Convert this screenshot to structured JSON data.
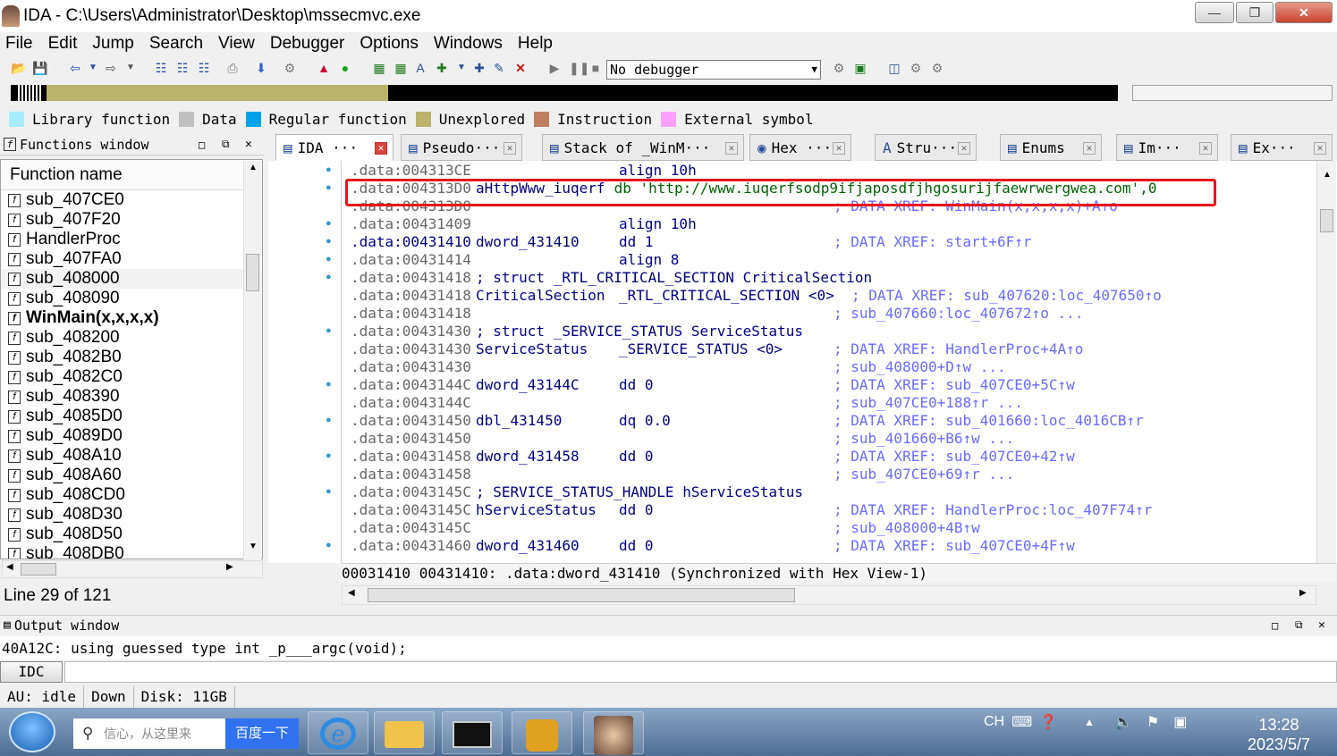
{
  "window": {
    "title": "IDA - C:\\Users\\Administrator\\Desktop\\mssecmvc.exe"
  },
  "menu": [
    "File",
    "Edit",
    "Jump",
    "Search",
    "View",
    "Debugger",
    "Options",
    "Windows",
    "Help"
  ],
  "toolbar": {
    "debugger_select": "No debugger"
  },
  "legend": [
    {
      "label": "Library function",
      "color": "#a7ecff"
    },
    {
      "label": "Data",
      "color": "#c0c0c0"
    },
    {
      "label": "Regular function",
      "color": "#00a2e8"
    },
    {
      "label": "Unexplored",
      "color": "#b9b36b"
    },
    {
      "label": "Instruction",
      "color": "#c08060"
    },
    {
      "label": "External symbol",
      "color": "#ffa0ff"
    }
  ],
  "functions": {
    "title": "Functions window",
    "column": "Function name",
    "items": [
      "sub_407CE0",
      "sub_407F20",
      "HandlerProc",
      "sub_407FA0",
      "sub_408000",
      "sub_408090",
      "WinMain(x,x,x,x)",
      "sub_408200",
      "sub_4082B0",
      "sub_4082C0",
      "sub_408390",
      "sub_4085D0",
      "sub_4089D0",
      "sub_408A10",
      "sub_408A60",
      "sub_408CD0",
      "sub_408D30",
      "sub_408D50",
      "sub_408DB0"
    ],
    "line_status": "Line 29 of 121"
  },
  "tabs": [
    "IDA ···",
    "Pseudo···",
    "Stack of _WinM···",
    "Hex ···",
    "Stru···",
    "Enums",
    "Im···",
    "Ex···"
  ],
  "disasm": {
    "lines": [
      {
        "addr": ".data:004313CE",
        "label": "",
        "op": "align 10h",
        "cmt": ""
      },
      {
        "addr": ".data:004313D0",
        "label": "aHttpWww_iuqerf",
        "op": "db 'http://www.iuqerfsodp9ifjaposdfjhgosurijfaewrwergwea.com',0",
        "cmt": ""
      },
      {
        "addr": ".data:004313D0",
        "label": "",
        "op": "",
        "cmt": "; DATA XREF: WinMain(x,x,x,x)+A↑o"
      },
      {
        "addr": ".data:00431409",
        "label": "",
        "op": "align 10h",
        "cmt": ""
      },
      {
        "addr": ".data:00431410",
        "label": "dword_431410",
        "op": "dd 1",
        "cmt": "; DATA XREF: start+6F↑r"
      },
      {
        "addr": ".data:00431414",
        "label": "",
        "op": "align 8",
        "cmt": ""
      },
      {
        "addr": ".data:00431418",
        "label": "; struct _RTL_CRITICAL_SECTION CriticalSection",
        "op": "",
        "cmt": ""
      },
      {
        "addr": ".data:00431418",
        "label": "CriticalSection",
        "op": "_RTL_CRITICAL_SECTION <0>",
        "cmt": "; DATA XREF: sub_407620:loc_407650↑o"
      },
      {
        "addr": ".data:00431418",
        "label": "",
        "op": "",
        "cmt": "; sub_407660:loc_407672↑o ..."
      },
      {
        "addr": ".data:00431430",
        "label": "; struct _SERVICE_STATUS ServiceStatus",
        "op": "",
        "cmt": ""
      },
      {
        "addr": ".data:00431430",
        "label": "ServiceStatus",
        "op": "_SERVICE_STATUS <0>",
        "cmt": "; DATA XREF: HandlerProc+4A↑o"
      },
      {
        "addr": ".data:00431430",
        "label": "",
        "op": "",
        "cmt": "; sub_408000+D↑w ..."
      },
      {
        "addr": ".data:0043144C",
        "label": "dword_43144C",
        "op": "dd 0",
        "cmt": "; DATA XREF: sub_407CE0+5C↑w"
      },
      {
        "addr": ".data:0043144C",
        "label": "",
        "op": "",
        "cmt": "; sub_407CE0+188↑r ..."
      },
      {
        "addr": ".data:00431450",
        "label": "dbl_431450",
        "op": "dq 0.0",
        "cmt": "; DATA XREF: sub_401660:loc_4016CB↑r"
      },
      {
        "addr": ".data:00431450",
        "label": "",
        "op": "",
        "cmt": "; sub_401660+B6↑w ..."
      },
      {
        "addr": ".data:00431458",
        "label": "dword_431458",
        "op": "dd 0",
        "cmt": "; DATA XREF: sub_407CE0+42↑w"
      },
      {
        "addr": ".data:00431458",
        "label": "",
        "op": "",
        "cmt": "; sub_407CE0+69↑r ..."
      },
      {
        "addr": ".data:0043145C",
        "label": "; SERVICE_STATUS_HANDLE hServiceStatus",
        "op": "",
        "cmt": ""
      },
      {
        "addr": ".data:0043145C",
        "label": "hServiceStatus",
        "op": "dd 0",
        "cmt": "; DATA XREF: HandlerProc:loc_407F74↑r"
      },
      {
        "addr": ".data:0043145C",
        "label": "",
        "op": "",
        "cmt": "; sub_408000+4B↑w"
      },
      {
        "addr": ".data:00431460",
        "label": "dword_431460",
        "op": "dd 0",
        "cmt": "; DATA XREF: sub_407CE0+4F↑w"
      }
    ],
    "sync_status": "00031410 00431410: .data:dword_431410 (Synchronized with Hex View-1)"
  },
  "output": {
    "title": "Output window",
    "text": "40A12C: using guessed type int _p___argc(void);",
    "idc_label": "IDC"
  },
  "status": {
    "au": "AU:  idle",
    "dir": "Down",
    "disk": "Disk: 11GB"
  },
  "taskbar": {
    "search_placeholder": "信心，从这里来",
    "search_button": "百度一下",
    "lang": "CH",
    "time": "13:28",
    "date": "2023/5/7"
  }
}
